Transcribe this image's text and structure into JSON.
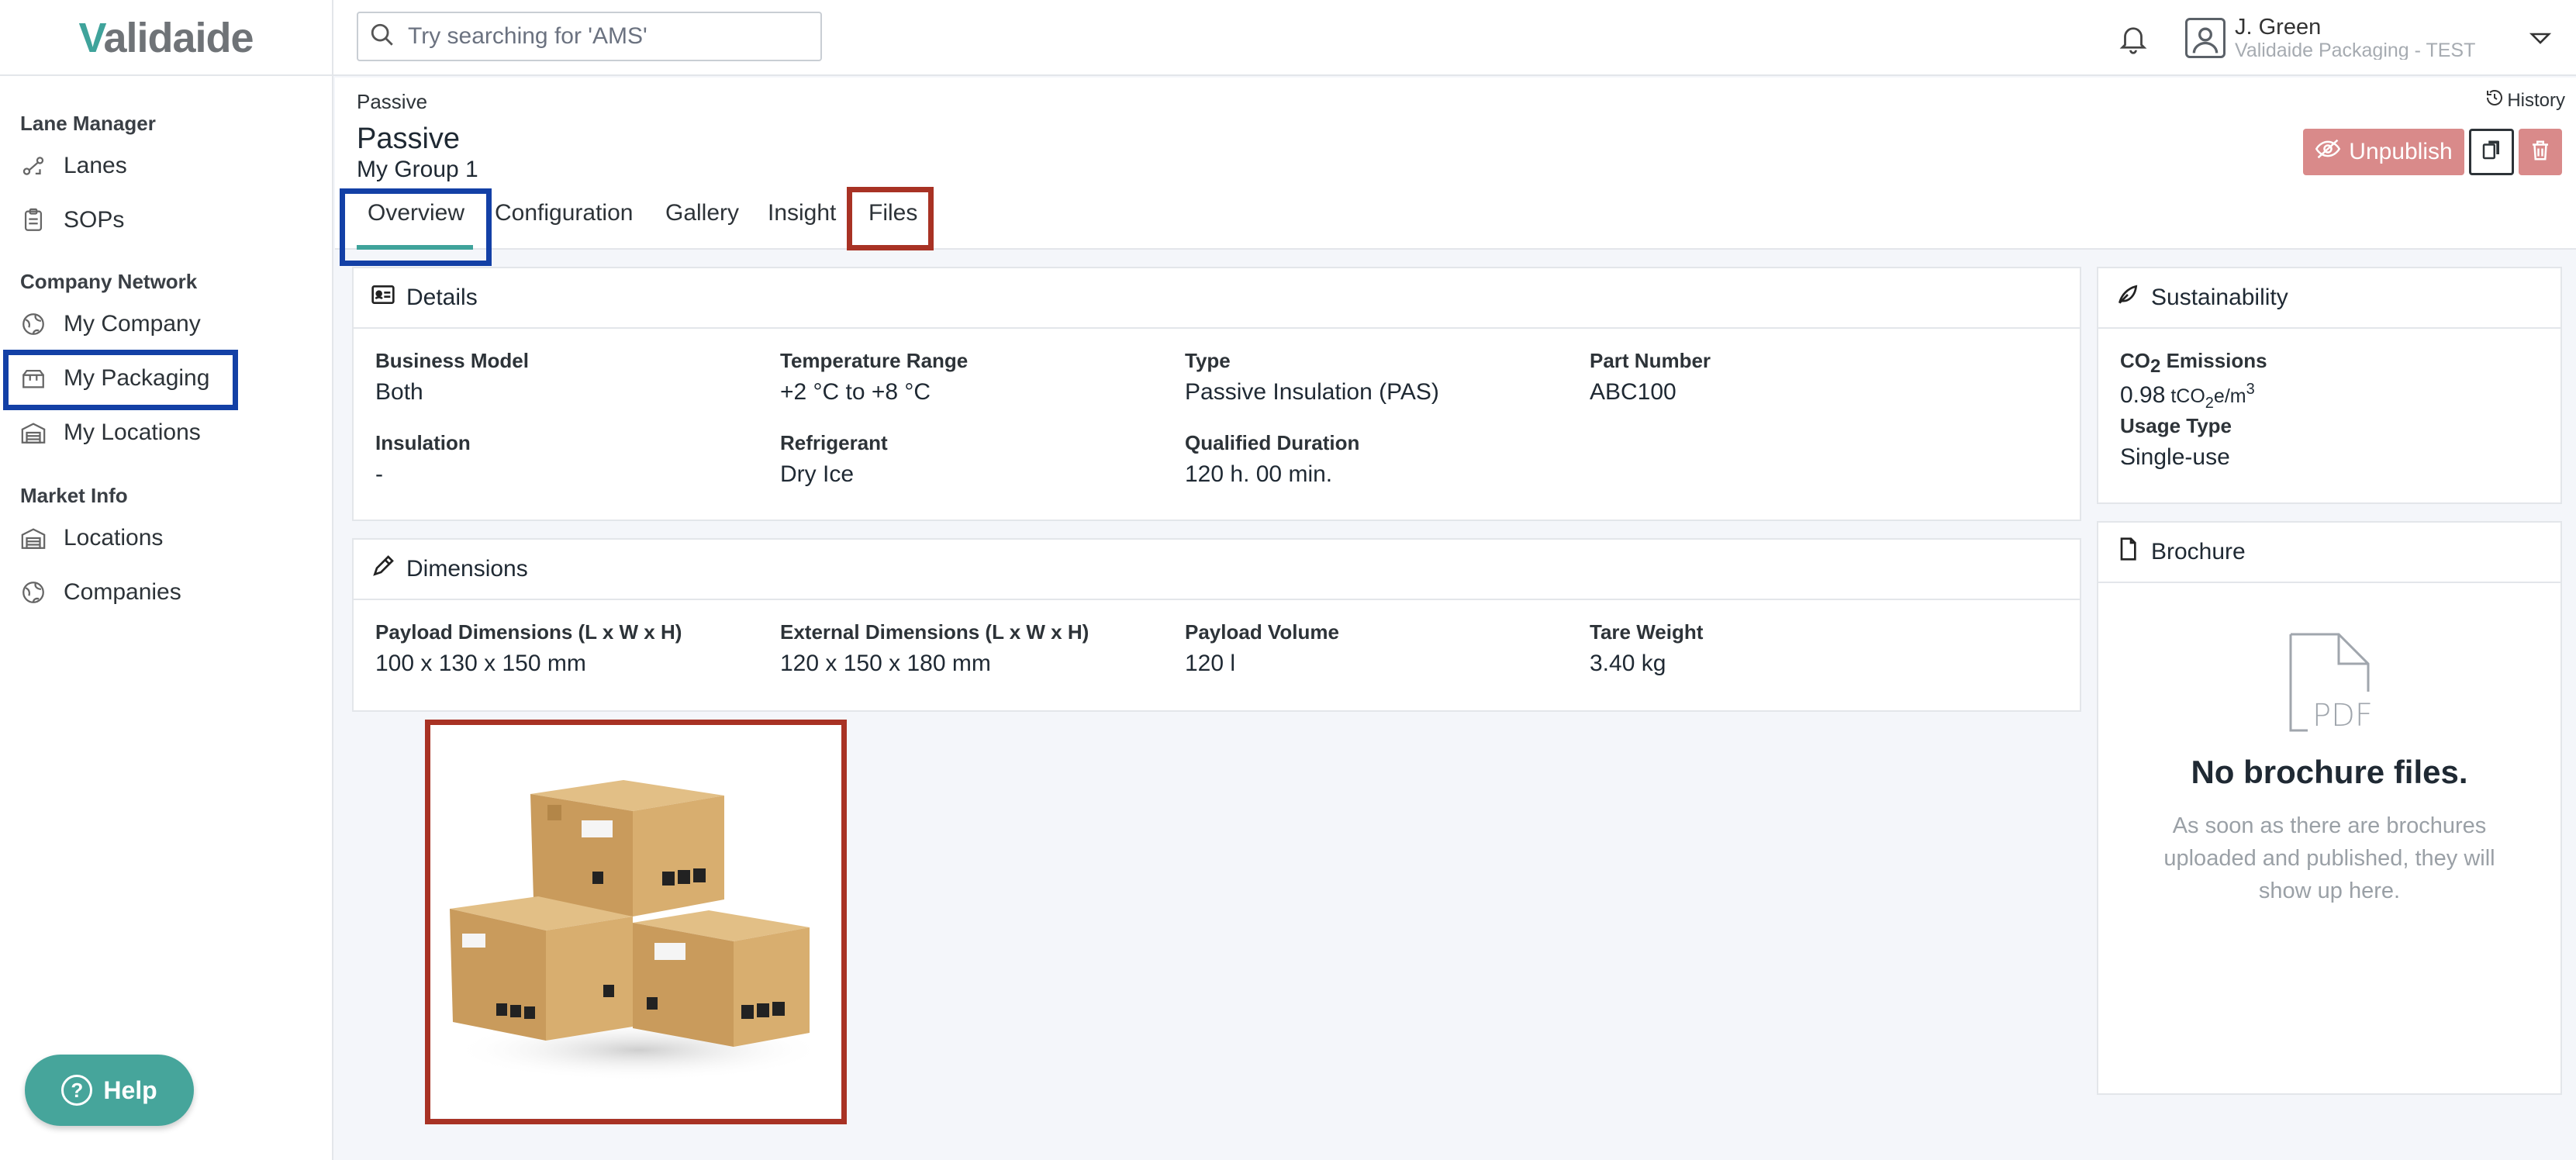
{
  "app": {
    "logo_prefix": "V",
    "logo_rest": "alidaide",
    "search_placeholder": "Try searching for 'AMS'"
  },
  "user": {
    "name": "J. Green",
    "org": "Validaide Packaging - TEST"
  },
  "sidebar": {
    "sections": [
      {
        "title": "Lane Manager",
        "items": [
          {
            "label": "Lanes",
            "icon": "lanes-icon"
          },
          {
            "label": "SOPs",
            "icon": "clipboard-icon"
          }
        ]
      },
      {
        "title": "Company Network",
        "items": [
          {
            "label": "My Company",
            "icon": "globe-icon"
          },
          {
            "label": "My Packaging",
            "icon": "packaging-icon"
          },
          {
            "label": "My Locations",
            "icon": "warehouse-icon"
          }
        ]
      },
      {
        "title": "Market Info",
        "items": [
          {
            "label": "Locations",
            "icon": "warehouse-icon"
          },
          {
            "label": "Companies",
            "icon": "globe-icon"
          }
        ]
      }
    ],
    "help_label": "Help"
  },
  "header": {
    "breadcrumb": "Passive",
    "history_label": "History",
    "title": "Passive",
    "subtitle": "My Group 1",
    "unpublish_label": "Unpublish",
    "tabs": [
      "Overview",
      "Configuration",
      "Gallery",
      "Insight",
      "Files"
    ],
    "active_tab": "Overview"
  },
  "details": {
    "title": "Details",
    "fields": [
      {
        "label": "Business Model",
        "value": "Both"
      },
      {
        "label": "Temperature Range",
        "value": "+2 °C to +8 °C"
      },
      {
        "label": "Type",
        "value": "Passive Insulation (PAS)"
      },
      {
        "label": "Part Number",
        "value": "ABC100"
      },
      {
        "label": "Insulation",
        "value": "-"
      },
      {
        "label": "Refrigerant",
        "value": "Dry Ice"
      },
      {
        "label": "Qualified Duration",
        "value": "120 h. 00 min."
      }
    ]
  },
  "dimensions": {
    "title": "Dimensions",
    "fields": [
      {
        "label": "Payload Dimensions (L x W x H)",
        "value": "100 x 130 x 150 mm"
      },
      {
        "label": "External Dimensions (L x W x H)",
        "value": "120 x 150 x 180 mm"
      },
      {
        "label": "Payload Volume",
        "value": "120 l"
      },
      {
        "label": "Tare Weight",
        "value": "3.40 kg"
      }
    ]
  },
  "sustainability": {
    "title": "Sustainability",
    "co2_label_prefix": "CO",
    "co2_label_sub": "2",
    "co2_label_suffix": " Emissions",
    "co2_value": "0.98",
    "co2_unit_a": " tCO",
    "co2_unit_sub": "2",
    "co2_unit_b": "e/m",
    "co2_unit_sup": "3",
    "usage_label": "Usage Type",
    "usage_value": "Single-use"
  },
  "brochure": {
    "title": "Brochure",
    "pdf_label": "PDF",
    "empty_title": "No brochure files.",
    "empty_text": "As soon as there are brochures uploaded and published, they will show up here."
  },
  "colors": {
    "accent": "#3fa39b",
    "highlight_blue": "#1340a6",
    "highlight_red": "#a83224",
    "danger": "#d98a8a"
  }
}
